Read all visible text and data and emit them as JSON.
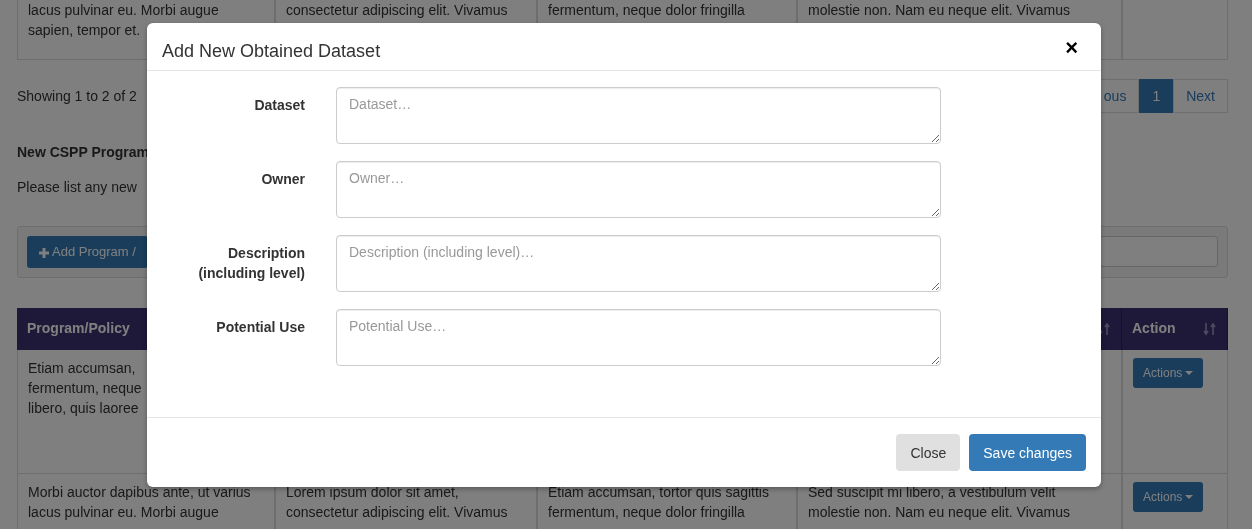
{
  "background": {
    "top_row": [
      [
        "lacus pulvinar eu. Morbi augue",
        "sapien, tempor et."
      ],
      [
        "consectetur adipiscing elit. Vivamus"
      ],
      [
        "fermentum, neque dolor fringilla"
      ],
      [
        "molestie non. Nam eu neque elit. Vivamus"
      ]
    ],
    "showing": "Showing 1 to 2 of 2",
    "pagination": [
      {
        "label": "ous",
        "selected": false
      },
      {
        "label": "1",
        "selected": true
      },
      {
        "label": "Next",
        "selected": false
      }
    ],
    "section_title": "New CSPP Program",
    "section_text": "Please list any new",
    "add_button": "Add Program /",
    "columns": [
      {
        "label": "Program/Policy"
      },
      {},
      {},
      {
        "sort": true
      },
      {
        "label": "Action",
        "sort": true
      }
    ],
    "rows": [
      {
        "cells": [
          [
            "Etiam accumsan,",
            "fermentum, neque",
            "libero, quis laoree"
          ],
          [],
          [],
          []
        ],
        "action": "Actions"
      },
      {
        "cells": [
          [
            "Morbi auctor dapibus ante, ut varius",
            "lacus pulvinar eu. Morbi augue"
          ],
          [
            "Lorem ipsum dolor sit amet,",
            "consectetur adipiscing elit. Vivamus"
          ],
          [
            "Etiam accumsan, tortor quis sagittis",
            "fermentum, neque dolor fringilla"
          ],
          [
            "Sed suscipit mi libero, a vestibulum velit",
            "molestie non. Nam eu neque elit. Vivamus"
          ]
        ],
        "action": "Actions"
      }
    ]
  },
  "modal": {
    "title": "Add New Obtained Dataset",
    "close": "×",
    "fields": [
      {
        "label": "Dataset",
        "placeholder": "Dataset…"
      },
      {
        "label": "Owner",
        "placeholder": "Owner…"
      },
      {
        "label": "Description (including level)",
        "placeholder": "Description (including level)…"
      },
      {
        "label": "Potential Use",
        "placeholder": "Potential Use…"
      }
    ],
    "buttons": [
      {
        "label": "Close",
        "kind": "secondary"
      },
      {
        "label": "Save changes",
        "kind": "primary"
      }
    ]
  }
}
